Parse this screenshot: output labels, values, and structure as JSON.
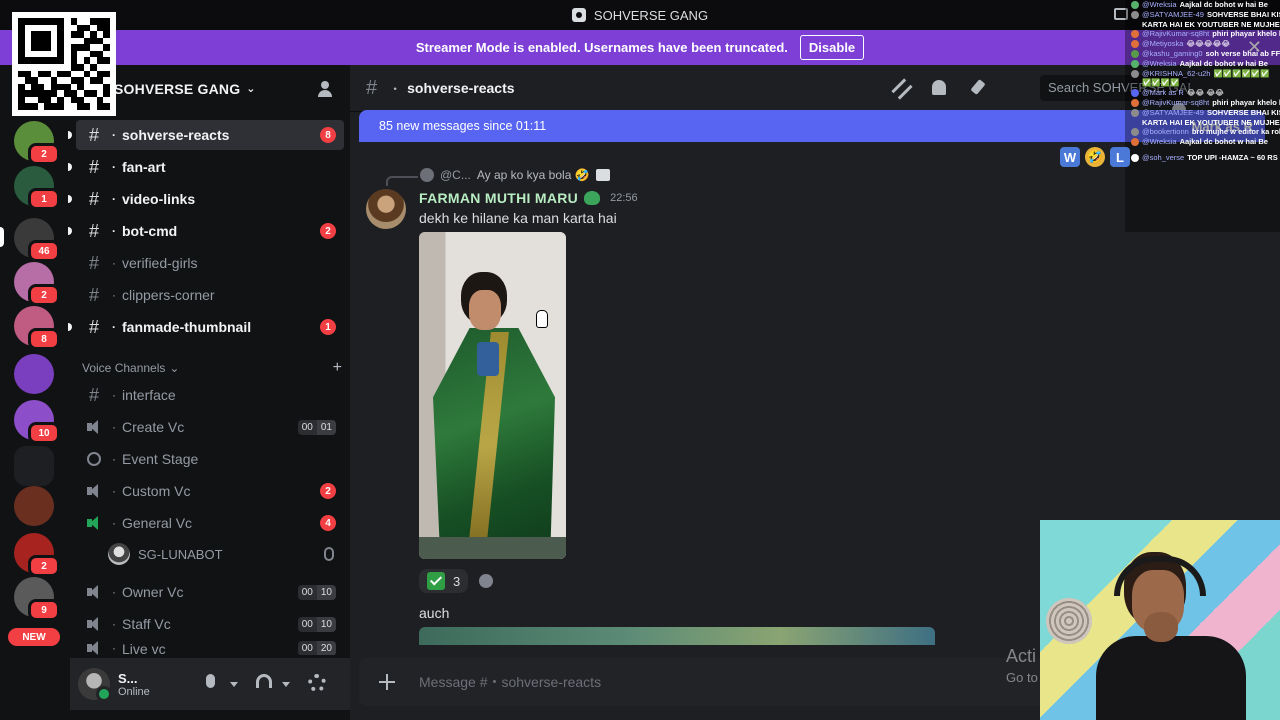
{
  "app": {
    "window_title": "SOHVERSE GANG"
  },
  "banner": {
    "text": "Streamer Mode is enabled. Usernames have been truncated.",
    "button": "Disable"
  },
  "rail": {
    "servers": [
      {
        "name": "turtle-server",
        "badge": "2",
        "color": "#5b8e3a"
      },
      {
        "name": "green-circle-server",
        "badge": "1",
        "color": "#2a5b3f"
      },
      {
        "name": "music-server",
        "badge": "46",
        "color": "#3a3a3a"
      },
      {
        "name": "cat-server",
        "badge": "2",
        "color": "#b76ea6"
      },
      {
        "name": "anime-server",
        "badge": "8",
        "color": "#c05c82"
      },
      {
        "name": "person-server",
        "badge": "",
        "color": "#7a3fbf"
      },
      {
        "name": "logo-server",
        "badge": "10",
        "color": "#8d4fc9"
      },
      {
        "name": "folder-server",
        "badge": "",
        "color": "#1e1f22"
      },
      {
        "name": "game-server",
        "badge": "",
        "color": "#6b2f20"
      },
      {
        "name": "red-server",
        "badge": "2",
        "color": "#a6231f"
      },
      {
        "name": "pixel-server",
        "badge": "9",
        "color": "#5a5a5a"
      }
    ],
    "new_label": "NEW"
  },
  "sidebar": {
    "guild_name": "SOHVERSE GANG",
    "text_channels": [
      {
        "name": "sohverse-reacts",
        "state": "active",
        "badge": "8"
      },
      {
        "name": "fan-art",
        "state": "unread",
        "badge": ""
      },
      {
        "name": "video-links",
        "state": "unread",
        "badge": ""
      },
      {
        "name": "bot-cmd",
        "state": "unread",
        "badge": "2"
      },
      {
        "name": "verified-girls",
        "state": "muted",
        "badge": ""
      },
      {
        "name": "clippers-corner",
        "state": "muted",
        "badge": ""
      },
      {
        "name": "fanmade-thumbnail",
        "state": "unread",
        "badge": "1"
      }
    ],
    "voice_category": "Voice Channels",
    "voice_channels": [
      {
        "name": "interface",
        "kind": "text",
        "badge": "",
        "counts": []
      },
      {
        "name": "Create Vc",
        "kind": "voice",
        "badge": "",
        "counts": [
          "00",
          "01"
        ]
      },
      {
        "name": "Event Stage",
        "kind": "stage",
        "badge": "",
        "counts": []
      },
      {
        "name": "Custom Vc",
        "kind": "voice",
        "badge": "2",
        "counts": []
      },
      {
        "name": "General Vc",
        "kind": "voice-active",
        "badge": "4",
        "counts": []
      },
      {
        "name": "Owner Vc",
        "kind": "voice",
        "badge": "",
        "counts": [
          "00",
          "10"
        ]
      },
      {
        "name": "Staff Vc",
        "kind": "voice",
        "badge": "",
        "counts": [
          "00",
          "10"
        ]
      },
      {
        "name": "Live vc",
        "kind": "voice",
        "badge": "",
        "counts": [
          "00",
          "20"
        ]
      }
    ],
    "voice_user": "SG-LUNABOT"
  },
  "user_panel": {
    "name": "S...",
    "status": "Online"
  },
  "channel": {
    "name": "sohverse-reacts",
    "search_placeholder": "Search SOHVERSE GANG",
    "new_messages": "85 new messages since 01:11",
    "mark_as_read": "Mark as R"
  },
  "message": {
    "reply_author": "@C...",
    "reply_text": "Ay ap ko kya bola 🤣",
    "author": "FARMAN MUTHI MARU",
    "time": "22:56",
    "text": "dekh ke hilane ka man karta hai",
    "reaction_count": "3",
    "next_text": "auch"
  },
  "composer": {
    "placeholder": "Message #・sohverse-reacts"
  },
  "watermark": {
    "line1": "Acti",
    "line2": "Go to"
  },
  "stream_chat": [
    {
      "user": "@Wreksia",
      "msg": "Aajkal dc bohot w hai Be",
      "color": "#56b36b"
    },
    {
      "user": "@SATYAMJEE-49",
      "msg": "SOHVERSE BHAI KISIKO",
      "color": "#8c8c8c"
    },
    {
      "user": "",
      "msg": "KARTA HAI EK YOUTUBER NE MUJHE BATA",
      "color": ""
    },
    {
      "user": "@RajivKumar-sq8ht",
      "msg": "phiri phayar khelo bhai",
      "color": "#e0703a"
    },
    {
      "user": "@Metiyoska",
      "msg": "😂😂😂😂😂",
      "color": "#e0703a"
    },
    {
      "user": "@kashu_gaming0",
      "msg": "soh verse bhai ab FF live",
      "color": "#5a9b4a"
    },
    {
      "user": "@Wreksia",
      "msg": "Aajkal dc bohot w hai Be",
      "color": "#56b36b"
    },
    {
      "user": "@KRISHNA_62-u2h",
      "msg": "✅✅✅✅✅✅",
      "color": "#8c8c8c"
    },
    {
      "user": "",
      "msg": "✅✅✅✅",
      "color": ""
    },
    {
      "user": "@Mark as R",
      "msg": "😂😂 😂😂",
      "color": "#5865f2"
    },
    {
      "user": "@RajivKumar-sq8ht",
      "msg": "phiri phayar khelo bhai",
      "color": "#e0703a"
    },
    {
      "user": "@SATYAMJEE-49",
      "msg": "SOHVERSE BHAI KISIKO",
      "color": "#8c8c8c"
    },
    {
      "user": "",
      "msg": "KARTA HAI EK YOUTUBER NE MUJHE BATA",
      "color": ""
    },
    {
      "user": "@bookertionn",
      "msg": "bro mujhe w editor ka role de",
      "color": "#8c8c8c"
    },
    {
      "user": "@Wreksia",
      "msg": "Aajkal dc bohot w hai Be",
      "color": "#e0703a"
    },
    {
      "user": "@soh_verse",
      "msg": "TOP UPI -HAMZA ~ 60 RS",
      "color": "#ffffff"
    }
  ],
  "overlay_badges": [
    "W",
    "🤣",
    "L"
  ]
}
